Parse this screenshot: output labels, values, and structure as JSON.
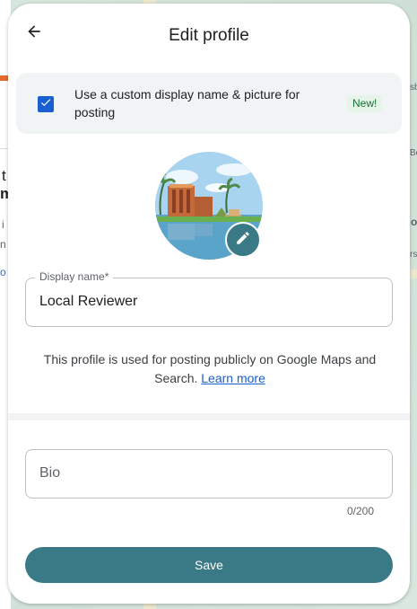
{
  "header": {
    "title": "Edit profile",
    "back_icon": "arrow-left-icon"
  },
  "custom_profile_option": {
    "checked": true,
    "label": "Use a custom display name & picture for posting",
    "badge": "New!"
  },
  "avatar": {
    "edit_icon": "pencil-icon"
  },
  "display_name": {
    "label": "Display name*",
    "value": "Local Reviewer"
  },
  "helper": {
    "text": "This profile is used for posting publicly on Google Maps and Search.",
    "link": "Learn more"
  },
  "bio": {
    "placeholder": "Bio",
    "counter": "0/200"
  },
  "save_button": {
    "label": "Save"
  },
  "colors": {
    "accent": "#3a7a86",
    "checkbox": "#1a5fd1",
    "badge_bg": "#e6f4ea",
    "badge_text": "#137333"
  }
}
